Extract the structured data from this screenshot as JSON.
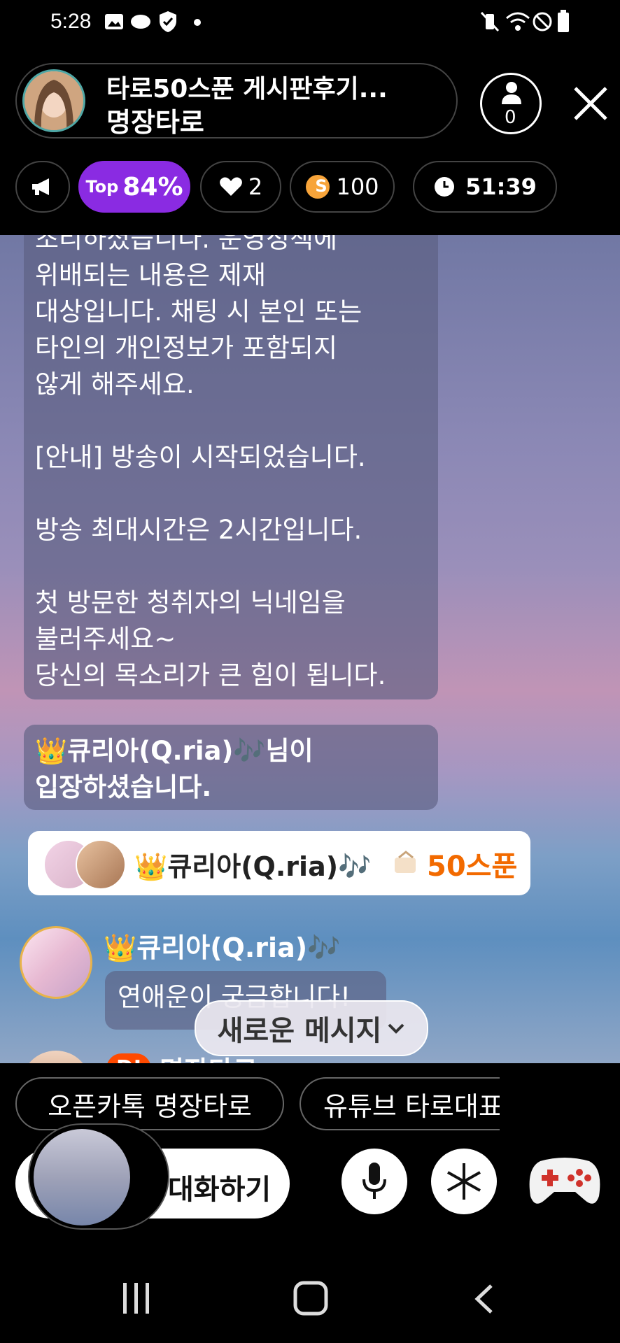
{
  "status_bar": {
    "time": "5:28",
    "left_icons": [
      "image-icon",
      "spoon-app-icon",
      "shield-check-icon",
      "dot-icon"
    ],
    "right_icons": [
      "vibrate-mute-icon",
      "wifi-icon",
      "do-not-disturb-icon",
      "battery-icon"
    ]
  },
  "header": {
    "room_title": "타로50스푼 게시판후기...",
    "host_name": "명장타로",
    "listener_count": "0"
  },
  "chips": {
    "top_prefix": "Top",
    "top_value": "84%",
    "likes": "2",
    "spoons": "100",
    "spoon_symbol": "S",
    "timer": "51:39"
  },
  "chat": {
    "notice_text": "조리하셨습니다. 운영정책에\n위배되는 내용은 제재\n대상입니다. 채팅 시 본인 또는\n타인의 개인정보가 포함되지\n않게 해주세요.\n\n[안내] 방송이 시작되었습니다.\n\n방송 최대시간은 2시간입니다.\n\n첫 방문한 청취자의 닉네임을\n불러주세요~\n당신의 목소리가 큰 힘이 됩니다.",
    "join_message": "👑큐리아(Q.ria)🎶님이\n입장하셨습니다.",
    "gift_user": "👑큐리아(Q.ria)🎶",
    "gift_amount": "50스푼",
    "message_user": "👑큐리아(Q.ria)🎶",
    "message_text": "연애운이 궁금합니다!",
    "dj_badge": "DJ",
    "dj_name": "명장타로",
    "new_message_button": "새로운 메시지"
  },
  "bottom": {
    "link_kakao": "오픈카톡 명장타로",
    "link_youtube": "유튜브 타로대표",
    "chat_input_label": "대화하기"
  },
  "colors": {
    "accent_purple": "#8a2be2",
    "spoon_orange": "#f26a00",
    "dj_orange": "#ff4a00",
    "background": "#000000"
  }
}
